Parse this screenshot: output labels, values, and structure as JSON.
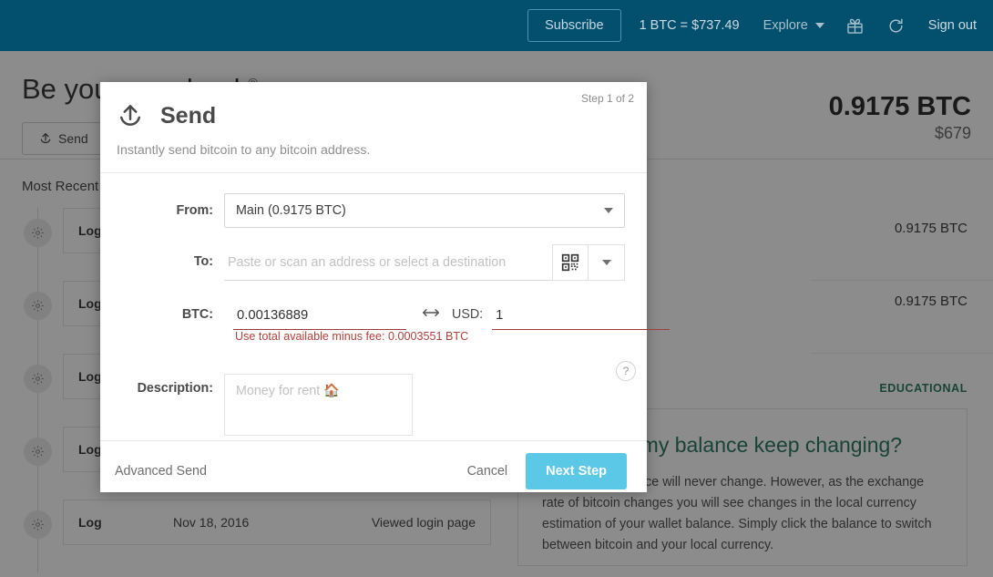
{
  "header": {
    "subscribe_label": "Subscribe",
    "rate_text": "1 BTC =  $737.49",
    "explore_label": "Explore",
    "gift_icon": "gift-icon",
    "refresh_icon": "refresh-icon",
    "signout_label": "Sign out",
    "brand_color": "#024f6e"
  },
  "hero": {
    "title": "Be your own bank",
    "registered_mark": "®",
    "send_button_label": "Send",
    "balance_btc": "0.9175 BTC",
    "balance_usd": "$679"
  },
  "activity": {
    "section_label": "Most Recent",
    "rows": [
      {
        "type": "Log",
        "date": "",
        "action": "",
        "amount": "0.9175 BTC"
      },
      {
        "type": "Log",
        "date": "",
        "action": "",
        "amount": "0.9175 BTC"
      },
      {
        "type": "Log",
        "date": "",
        "action": "",
        "amount": ""
      },
      {
        "type": "Log",
        "date": "",
        "action": "",
        "amount": ""
      },
      {
        "type": "Log",
        "date": "Nov 18, 2016",
        "action": "Viewed login page",
        "amount": ""
      }
    ]
  },
  "educational": {
    "badge": "EDUCATIONAL",
    "badge_color": "#2e7d62",
    "title": "Why does my balance keep changing?",
    "body": "Your bitcoin balance will never change. However, as the exchange rate of bitcoin changes you will see changes in the local currency estimation of your wallet balance. Simply click the balance to switch between bitcoin and your local currency."
  },
  "modal": {
    "step_indicator": "Step 1 of 2",
    "icon": "upload-send-icon",
    "title": "Send",
    "subtitle": "Instantly send bitcoin to any bitcoin address.",
    "from": {
      "label": "From:",
      "value": "Main  (0.9175 BTC)"
    },
    "to": {
      "label": "To:",
      "value": "",
      "placeholder": "Paste or scan an address or select a destination",
      "qr_icon": "qr-code-icon",
      "dropdown_icon": "chevron-down-icon"
    },
    "amount": {
      "btc_label": "BTC:",
      "btc_value": "0.00136889",
      "swap_icon": "left-right-arrow-icon",
      "usd_label": "USD:",
      "usd_value": "1",
      "error_message": "Use total available minus fee: 0.0003551 BTC",
      "error_color": "#b1413b"
    },
    "description": {
      "label": "Description:",
      "value": "",
      "placeholder": "Money for rent 🏠",
      "help_icon": "question-mark-icon"
    },
    "footer": {
      "advanced_label": "Advanced Send",
      "cancel_label": "Cancel",
      "next_label": "Next Step",
      "next_color": "#5bc8e8"
    }
  }
}
